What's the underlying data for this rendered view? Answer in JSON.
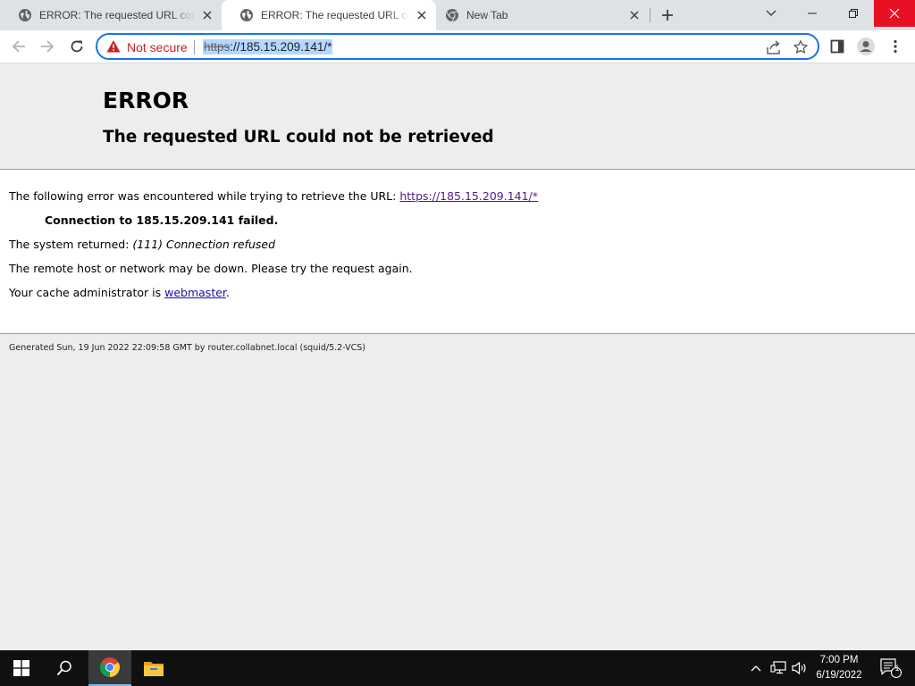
{
  "browser": {
    "tabs": [
      {
        "title": "ERROR: The requested URL could not be retrieved",
        "icon": "globe-icon"
      },
      {
        "title": "ERROR: The requested URL could not be retrieved",
        "icon": "globe-icon"
      },
      {
        "title": "New Tab",
        "icon": "chrome-icon"
      }
    ],
    "security_label": "Not secure",
    "url_scheme": "https",
    "url_rest": "://185.15.209.141/*"
  },
  "page": {
    "title": "ERROR",
    "subtitle": "The requested URL could not be retrieved",
    "line1_text": "The following error was encountered while trying to retrieve the URL: ",
    "line1_link": "https://185.15.209.141/*",
    "line2": "Connection to 185.15.209.141 failed.",
    "line3_prefix": "The system returned: ",
    "line3_em": "(111) Connection refused",
    "line4": "The remote host or network may be down. Please try the request again.",
    "line5_prefix": "Your cache administrator is ",
    "line5_link": "webmaster",
    "line5_suffix": ".",
    "footer": "Generated Sun, 19 Jun 2022 22:09:58 GMT by router.collabnet.local (squid/5.2-VCS)"
  },
  "taskbar": {
    "time": "7:00 PM",
    "date": "6/19/2022",
    "notification_count": "1"
  },
  "colors": {
    "accent": "#1a73e8",
    "not_secure": "#c5221f",
    "link": "#1a0dab",
    "link_visited": "#551a8b",
    "close_button_hover": "#e81123"
  }
}
